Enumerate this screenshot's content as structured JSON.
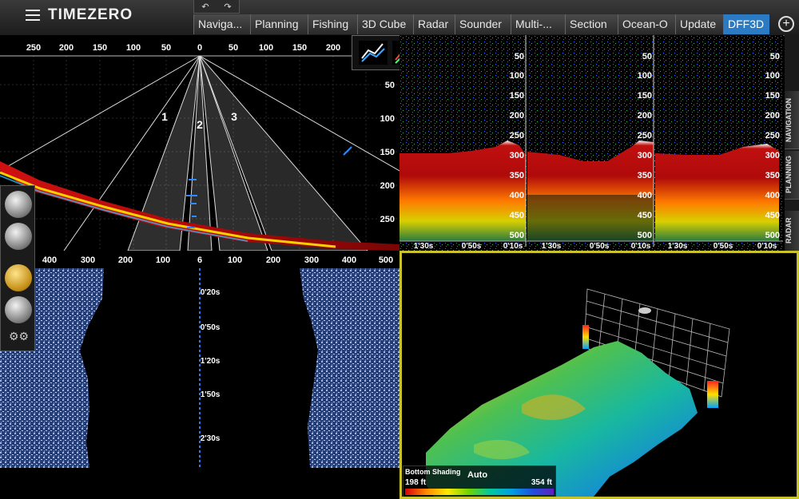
{
  "app": {
    "brand": "TIMEZERO",
    "undo_glyph": "↶",
    "redo_glyph": "↷"
  },
  "tabs": [
    {
      "label": "Naviga...",
      "active": false
    },
    {
      "label": "Planning",
      "active": false
    },
    {
      "label": "Fishing",
      "active": false
    },
    {
      "label": "3D Cube",
      "active": false
    },
    {
      "label": "Radar",
      "active": false
    },
    {
      "label": "Sounder",
      "active": false
    },
    {
      "label": "Multi-...",
      "active": false
    },
    {
      "label": "Section",
      "active": false
    },
    {
      "label": "Ocean-O",
      "active": false
    },
    {
      "label": "Update",
      "active": false
    },
    {
      "label": "DFF3D",
      "active": true
    }
  ],
  "add_tab_glyph": "+",
  "side_tabs": [
    "NAVIGATION",
    "PLANNING",
    "RADAR"
  ],
  "fan": {
    "top_scale": [
      "250",
      "200",
      "150",
      "100",
      "50",
      "0",
      "50",
      "100",
      "150",
      "200",
      "250"
    ],
    "depth_scale": [
      "50",
      "100",
      "150",
      "200",
      "250"
    ],
    "beam_labels": [
      "1",
      "2",
      "3"
    ]
  },
  "sidescan": {
    "top_scale": [
      "500",
      "400",
      "300",
      "200",
      "100",
      "6",
      "100",
      "200",
      "300",
      "400",
      "500"
    ],
    "time_labels": [
      "0'20s",
      "0'50s",
      "1'20s",
      "1'50s",
      "2'30s"
    ]
  },
  "echo": {
    "depth_labels": [
      "50",
      "100",
      "150",
      "200",
      "250",
      "300",
      "350",
      "400",
      "450",
      "500"
    ],
    "time_labels": [
      "1'30s",
      "0'50s",
      "0'10s"
    ]
  },
  "dff3d": {
    "legend_title": "Bottom Shading",
    "mode": "Auto",
    "min_label": "198 ft",
    "max_label": "354 ft"
  },
  "icons": {
    "tool_icons": [
      "transducer-icon",
      "range-icon",
      "hand-pan-icon",
      "center-icon",
      "settings-gear-icon"
    ],
    "scale_icons": [
      "zoom-chart-icon",
      "color-chart-icon",
      "gear-lock-icon"
    ]
  }
}
